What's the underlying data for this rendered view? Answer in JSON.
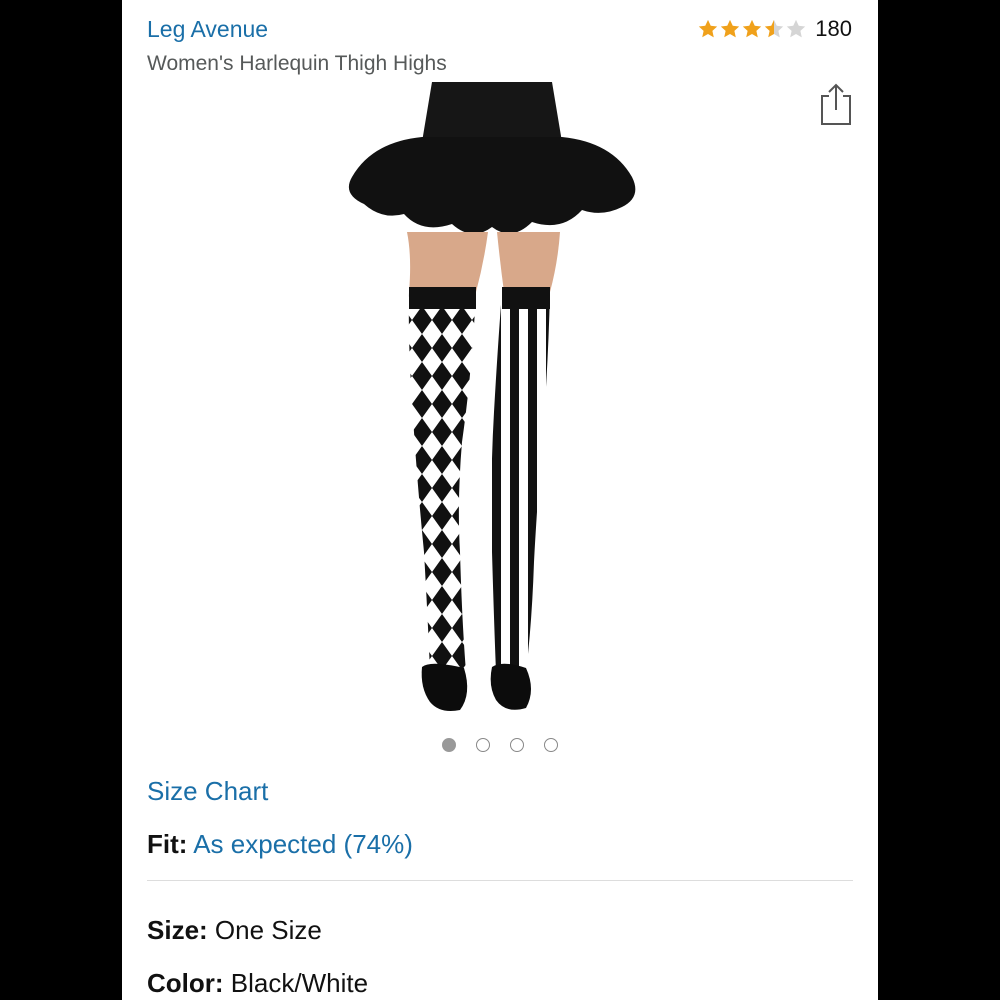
{
  "product": {
    "brand": "Leg Avenue",
    "title": "Women's Harlequin Thigh Highs",
    "rating_count": "180",
    "rating_value": 3.5,
    "star_color": "#f0a11b",
    "star_empty_color": "#d5d5d5"
  },
  "gallery": {
    "dot_count": 4,
    "active_index": 0
  },
  "details": {
    "size_chart_label": "Size Chart",
    "fit_label": "Fit:",
    "fit_value": "As expected (74%)",
    "size_label": "Size:",
    "size_value": "One Size",
    "color_label": "Color:",
    "color_value": "Black/White"
  },
  "colors": {
    "link": "#1a6fa8",
    "text": "#111111",
    "muted": "#565959"
  }
}
